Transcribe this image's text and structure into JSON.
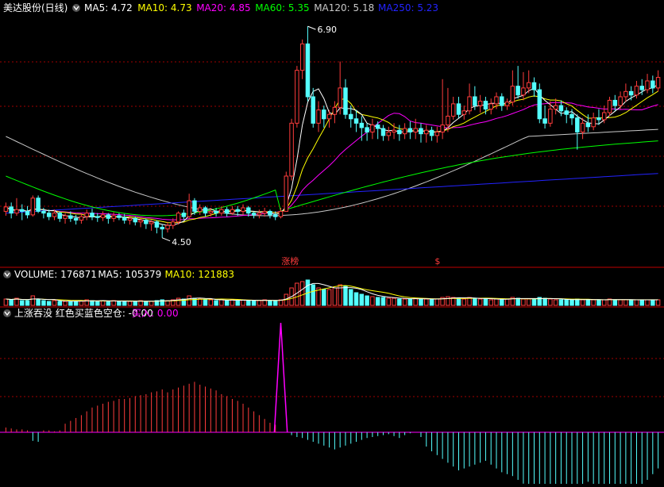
{
  "colors": {
    "bg": "#000000",
    "up": "#ff3c3c",
    "down": "#54ffff",
    "ma5": "#ffffff",
    "ma10": "#ffff00",
    "ma20": "#ff00ff",
    "ma60": "#00ff00",
    "ma120": "#c8c8c8",
    "ma250": "#2323ff",
    "grid": "#a00000",
    "separator": "#c00000",
    "text": "#ffffff"
  },
  "main_panel": {
    "title": "美达股份(日线)",
    "collapse_icon": "chevron-down-icon",
    "legend": [
      {
        "label": "MA5: 4.72",
        "color": "#ffffff"
      },
      {
        "label": "MA10: 4.73",
        "color": "#ffff00"
      },
      {
        "label": "MA20: 4.85",
        "color": "#ff00ff"
      },
      {
        "label": "MA60: 5.35",
        "color": "#00ff00"
      },
      {
        "label": "MA120: 5.18",
        "color": "#c8c8c8"
      },
      {
        "label": "MA250: 5.23",
        "color": "#2323ff"
      }
    ],
    "high_label": "6.90",
    "low_label": "4.50",
    "markers": [
      {
        "label": "涨榜",
        "color": "#ff3c3c"
      },
      {
        "label": "$",
        "color": "#ff3c3c"
      }
    ]
  },
  "volume_panel": {
    "collapse_icon": "chevron-down-icon",
    "legend": [
      {
        "label": "VOLUME: 176871",
        "color": "#ffffff"
      },
      {
        "label": "MA5: 105379",
        "color": "#ffffff"
      },
      {
        "label": "MA10: 121883",
        "color": "#ffff00"
      }
    ]
  },
  "indicator_panel": {
    "collapse_icon": "chevron-down-icon",
    "legend": [
      {
        "label": "上涨吞没  红色买蓝色空仓: -0.00",
        "color": "#ffffff"
      },
      {
        "label": "买入: 0.00",
        "color": "#ff00ff"
      }
    ]
  },
  "chart_data": [
    {
      "type": "candlestick",
      "ylim": [
        4.3,
        7.0
      ],
      "high_marker": 6.9,
      "low_marker": 4.5,
      "candles": [
        [
          4.8,
          4.85,
          4.75,
          4.9
        ],
        [
          4.85,
          4.78,
          4.72,
          4.9
        ],
        [
          4.78,
          4.82,
          4.75,
          4.95
        ],
        [
          4.82,
          4.8,
          4.7,
          4.88
        ],
        [
          4.8,
          4.76,
          4.72,
          4.86
        ],
        [
          4.76,
          4.95,
          4.74,
          4.98
        ],
        [
          4.95,
          4.8,
          4.78,
          4.98
        ],
        [
          4.8,
          4.78,
          4.72,
          4.84
        ],
        [
          4.78,
          4.74,
          4.7,
          4.82
        ],
        [
          4.74,
          4.78,
          4.7,
          4.82
        ],
        [
          4.78,
          4.72,
          4.68,
          4.8
        ],
        [
          4.72,
          4.75,
          4.66,
          4.78
        ],
        [
          4.75,
          4.72,
          4.68,
          4.8
        ],
        [
          4.72,
          4.7,
          4.65,
          4.76
        ],
        [
          4.7,
          4.74,
          4.66,
          4.78
        ],
        [
          4.74,
          4.78,
          4.7,
          4.82
        ],
        [
          4.78,
          4.74,
          4.7,
          4.83
        ],
        [
          4.74,
          4.73,
          4.68,
          4.78
        ],
        [
          4.73,
          4.76,
          4.69,
          4.8
        ],
        [
          4.76,
          4.72,
          4.66,
          4.78
        ],
        [
          4.72,
          4.75,
          4.68,
          4.79
        ],
        [
          4.75,
          4.73,
          4.7,
          4.78
        ],
        [
          4.73,
          4.7,
          4.66,
          4.77
        ],
        [
          4.7,
          4.72,
          4.65,
          4.75
        ],
        [
          4.72,
          4.68,
          4.64,
          4.74
        ],
        [
          4.68,
          4.7,
          4.62,
          4.72
        ],
        [
          4.7,
          4.66,
          4.6,
          4.72
        ],
        [
          4.66,
          4.68,
          4.58,
          4.7
        ],
        [
          4.68,
          4.62,
          4.55,
          4.7
        ],
        [
          4.62,
          4.6,
          4.5,
          4.65
        ],
        [
          4.6,
          4.64,
          4.56,
          4.68
        ],
        [
          4.64,
          4.68,
          4.6,
          4.72
        ],
        [
          4.68,
          4.78,
          4.65,
          4.8
        ],
        [
          4.78,
          4.74,
          4.7,
          4.82
        ],
        [
          4.74,
          4.92,
          4.72,
          5.0
        ],
        [
          4.92,
          4.8,
          4.76,
          4.95
        ],
        [
          4.8,
          4.84,
          4.76,
          4.88
        ],
        [
          4.84,
          4.78,
          4.74,
          4.86
        ],
        [
          4.78,
          4.8,
          4.74,
          4.84
        ],
        [
          4.8,
          4.78,
          4.74,
          4.84
        ],
        [
          4.78,
          4.82,
          4.75,
          4.86
        ],
        [
          4.82,
          4.78,
          4.74,
          4.85
        ],
        [
          4.78,
          4.82,
          4.76,
          4.86
        ],
        [
          4.82,
          4.8,
          4.75,
          4.86
        ],
        [
          4.8,
          4.84,
          4.76,
          4.88
        ],
        [
          4.84,
          4.78,
          4.74,
          4.86
        ],
        [
          4.78,
          4.76,
          4.72,
          4.8
        ],
        [
          4.76,
          4.78,
          4.72,
          4.82
        ],
        [
          4.78,
          4.8,
          4.74,
          4.84
        ],
        [
          4.8,
          4.76,
          4.72,
          4.82
        ],
        [
          4.76,
          4.74,
          4.7,
          4.8
        ],
        [
          4.74,
          4.8,
          4.72,
          4.84
        ],
        [
          4.8,
          5.2,
          4.8,
          5.25
        ],
        [
          5.2,
          5.8,
          5.15,
          5.85
        ],
        [
          5.8,
          6.4,
          5.75,
          6.45
        ],
        [
          6.4,
          6.7,
          6.3,
          6.75
        ],
        [
          6.7,
          6.1,
          6.05,
          6.9
        ],
        [
          6.1,
          5.8,
          5.75,
          6.2
        ],
        [
          5.8,
          5.95,
          5.7,
          6.05
        ],
        [
          5.95,
          5.85,
          5.75,
          6.0
        ],
        [
          5.85,
          5.9,
          5.75,
          5.95
        ],
        [
          5.9,
          5.98,
          5.8,
          6.05
        ],
        [
          5.98,
          6.2,
          5.9,
          6.5
        ],
        [
          6.2,
          5.9,
          5.85,
          6.3
        ],
        [
          5.9,
          5.85,
          5.75,
          6.0
        ],
        [
          5.85,
          5.8,
          5.7,
          5.95
        ],
        [
          5.8,
          5.75,
          5.6,
          5.88
        ],
        [
          5.75,
          5.7,
          5.6,
          5.8
        ],
        [
          5.7,
          5.78,
          5.62,
          5.85
        ],
        [
          5.78,
          5.74,
          5.62,
          5.82
        ],
        [
          5.74,
          5.66,
          5.6,
          5.78
        ],
        [
          5.66,
          5.7,
          5.6,
          5.76
        ],
        [
          5.7,
          5.72,
          5.62,
          5.8
        ],
        [
          5.72,
          5.68,
          5.6,
          5.78
        ],
        [
          5.68,
          5.74,
          5.62,
          5.8
        ],
        [
          5.74,
          5.7,
          5.62,
          5.82
        ],
        [
          5.7,
          5.74,
          5.62,
          5.85
        ],
        [
          5.74,
          5.68,
          5.58,
          5.8
        ],
        [
          5.68,
          5.72,
          5.58,
          5.78
        ],
        [
          5.72,
          5.66,
          5.6,
          5.76
        ],
        [
          5.66,
          5.7,
          5.58,
          5.76
        ],
        [
          5.7,
          5.78,
          5.62,
          6.3
        ],
        [
          5.78,
          5.88,
          5.7,
          6.2
        ],
        [
          5.88,
          6.02,
          5.84,
          6.1
        ],
        [
          6.02,
          5.9,
          5.86,
          6.1
        ],
        [
          5.9,
          5.94,
          5.84,
          6.0
        ],
        [
          5.94,
          6.1,
          5.9,
          6.25
        ],
        [
          6.1,
          6.0,
          5.95,
          6.22
        ],
        [
          6.0,
          6.05,
          5.92,
          6.12
        ],
        [
          6.05,
          5.96,
          5.9,
          6.1
        ],
        [
          5.96,
          6.02,
          5.9,
          6.08
        ],
        [
          6.02,
          6.1,
          5.96,
          6.15
        ],
        [
          6.1,
          6.0,
          5.94,
          6.14
        ],
        [
          6.0,
          6.04,
          5.95,
          6.08
        ],
        [
          6.04,
          6.22,
          6.0,
          6.4
        ],
        [
          6.22,
          6.12,
          6.08,
          6.45
        ],
        [
          6.12,
          6.2,
          6.06,
          6.38
        ],
        [
          6.2,
          6.26,
          6.14,
          6.4
        ],
        [
          6.26,
          6.18,
          6.1,
          6.32
        ],
        [
          6.18,
          5.85,
          5.8,
          6.25
        ],
        [
          5.85,
          5.8,
          5.74,
          6.0
        ],
        [
          5.8,
          5.96,
          5.76,
          6.05
        ],
        [
          5.96,
          6.0,
          5.9,
          6.08
        ],
        [
          6.0,
          5.94,
          5.88,
          6.06
        ],
        [
          5.94,
          5.9,
          5.8,
          5.98
        ],
        [
          5.9,
          5.86,
          5.78,
          5.96
        ],
        [
          5.86,
          5.7,
          5.5,
          5.9
        ],
        [
          5.7,
          5.8,
          5.62,
          5.86
        ],
        [
          5.8,
          5.76,
          5.7,
          5.9
        ],
        [
          5.76,
          5.86,
          5.72,
          5.92
        ],
        [
          5.86,
          5.84,
          5.78,
          5.96
        ],
        [
          5.84,
          5.92,
          5.8,
          6.0
        ],
        [
          5.92,
          6.06,
          5.88,
          6.1
        ],
        [
          6.06,
          6.0,
          5.94,
          6.12
        ],
        [
          6.0,
          6.1,
          5.96,
          6.16
        ],
        [
          6.1,
          6.16,
          6.04,
          6.25
        ],
        [
          6.16,
          6.12,
          6.06,
          6.22
        ],
        [
          6.12,
          6.22,
          6.08,
          6.28
        ],
        [
          6.22,
          6.18,
          6.12,
          6.3
        ],
        [
          6.18,
          6.28,
          6.14,
          6.36
        ],
        [
          6.28,
          6.2,
          6.14,
          6.34
        ],
        [
          6.2,
          6.32,
          6.16,
          6.4
        ]
      ],
      "volume": [
        8,
        7,
        9,
        6,
        6,
        12,
        8,
        6,
        5,
        6,
        5,
        5,
        5,
        5,
        6,
        7,
        6,
        5,
        6,
        5,
        6,
        5,
        5,
        5,
        5,
        6,
        5,
        5,
        6,
        7,
        6,
        7,
        9,
        8,
        12,
        9,
        8,
        7,
        7,
        6,
        7,
        6,
        7,
        6,
        7,
        6,
        6,
        6,
        7,
        6,
        6,
        7,
        14,
        22,
        28,
        30,
        32,
        26,
        22,
        20,
        20,
        22,
        26,
        24,
        20,
        16,
        14,
        12,
        11,
        10,
        10,
        9,
        9,
        8,
        8,
        8,
        9,
        8,
        8,
        7,
        8,
        10,
        11,
        10,
        9,
        8,
        10,
        9,
        8,
        8,
        7,
        8,
        8,
        8,
        10,
        9,
        8,
        8,
        8,
        10,
        9,
        8,
        7,
        7,
        7,
        7,
        8,
        7,
        7,
        7,
        7,
        7,
        8,
        7,
        7,
        7,
        7,
        7,
        7,
        7,
        7,
        7
      ],
      "indicator": [
        0.5,
        0.4,
        0.3,
        0.3,
        0.2,
        -0.9,
        -1.0,
        0.2,
        0.2,
        0.1,
        0.2,
        0.9,
        1.2,
        1.5,
        1.8,
        2.2,
        2.6,
        2.8,
        3.0,
        3.2,
        3.3,
        3.5,
        3.5,
        3.6,
        3.8,
        3.9,
        4.0,
        4.2,
        4.3,
        4.5,
        4.2,
        4.5,
        4.7,
        4.9,
        5.1,
        5.3,
        5.0,
        4.8,
        4.6,
        4.4,
        4.0,
        3.8,
        3.5,
        3.3,
        3.0,
        2.6,
        2.2,
        1.8,
        1.4,
        1.0,
        0.8,
        10.0,
        0.0,
        -0.3,
        -0.5,
        -0.6,
        -0.8,
        -1.0,
        -1.2,
        -1.4,
        -1.6,
        -1.8,
        -1.6,
        -1.4,
        -1.2,
        -1.0,
        -0.8,
        -0.6,
        -0.5,
        -0.4,
        -0.3,
        -0.2,
        -0.4,
        -0.6,
        -0.3,
        -0.1,
        0.0,
        -0.5,
        -1.5,
        -2.0,
        -2.4,
        -2.8,
        -3.2,
        -3.6,
        -4.0,
        -3.8,
        -3.6,
        -3.4,
        -3.2,
        -3.0,
        -3.4,
        -3.8,
        -4.2,
        -4.4,
        -4.6,
        -5.0,
        -5.4,
        -5.8,
        -6.2,
        -6.6,
        -7.0,
        -7.4,
        -7.6,
        -7.2,
        -6.8,
        -6.4,
        -6.0,
        -5.6,
        -5.2,
        -5.8,
        -6.4,
        -7.0,
        -7.6,
        -7.8,
        -8.0,
        -7.4,
        -6.8,
        -6.2,
        -5.6,
        -5.0,
        -4.4,
        -3.8
      ],
      "indicator_spike_index": 51
    }
  ]
}
